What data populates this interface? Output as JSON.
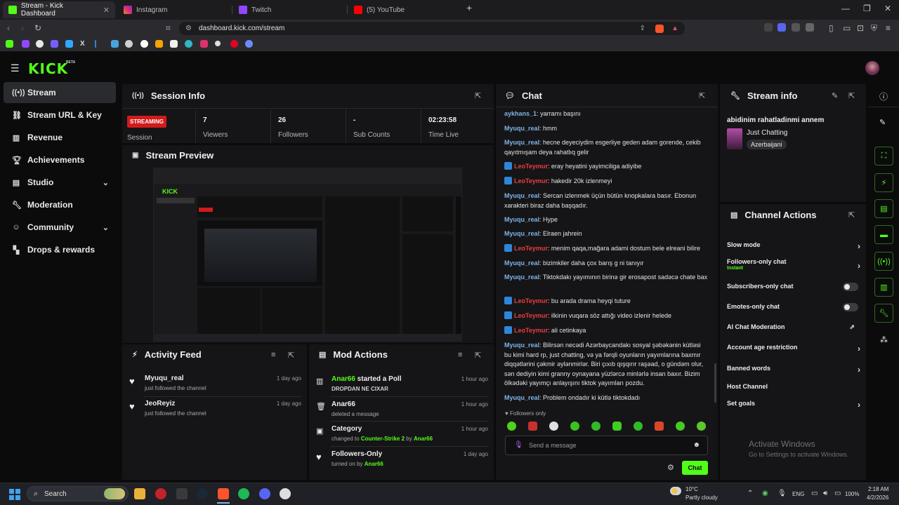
{
  "browser": {
    "tabs": [
      {
        "title": "Stream - Kick Dashboard",
        "color": "#53fc18",
        "active": true
      },
      {
        "title": "Instagram",
        "color": "#e1306c",
        "active": false
      },
      {
        "title": "Twitch",
        "color": "#9146ff",
        "active": false
      },
      {
        "title": "(5) YouTube",
        "color": "#ff0000",
        "active": false
      }
    ],
    "url": "dashboard.kick.com/stream"
  },
  "header": {
    "logo": "KICK",
    "beta": "BETA"
  },
  "sidebar": {
    "items": [
      {
        "label": "Stream",
        "icon": "stream-icon"
      },
      {
        "label": "Stream URL & Key",
        "icon": "link-icon"
      },
      {
        "label": "Revenue",
        "icon": "chart-icon"
      },
      {
        "label": "Achievements",
        "icon": "trophy-icon"
      },
      {
        "label": "Studio",
        "icon": "studio-icon"
      },
      {
        "label": "Moderation",
        "icon": "wrench-icon"
      },
      {
        "label": "Community",
        "icon": "community-icon"
      },
      {
        "label": "Drops & rewards",
        "icon": "drops-icon"
      }
    ]
  },
  "session": {
    "title": "Session Info",
    "status": "STREAMING",
    "stats": [
      {
        "value": "",
        "label": "Session"
      },
      {
        "value": "7",
        "label": "Viewers"
      },
      {
        "value": "26",
        "label": "Followers"
      },
      {
        "value": "-",
        "label": "Sub Counts"
      },
      {
        "value": "02:23:58",
        "label": "Time Live"
      }
    ]
  },
  "preview": {
    "title": "Stream Preview"
  },
  "activity": {
    "title": "Activity Feed",
    "items": [
      {
        "name": "Myuqu_real",
        "sub": "just followed the channel",
        "time": "1 day ago"
      },
      {
        "name": "JeoReyiz",
        "sub": "just followed the channel",
        "time": "1 day ago"
      }
    ]
  },
  "mod": {
    "title": "Mod Actions",
    "items": [
      {
        "user": "Anar66",
        "action": " started a Poll",
        "sub": "DROPDAN NE CIXAR",
        "time": "1 hour ago"
      },
      {
        "user": "Anar66",
        "action": "",
        "sub": "deleted a message",
        "time": "1 hour ago"
      },
      {
        "user": "",
        "action": "Category",
        "sub_pre": "changed to ",
        "sub_green": "Counter-Strike 2",
        "sub_mid": " by ",
        "sub_user": "Anar66",
        "time": "1 hour ago"
      },
      {
        "user": "",
        "action": "Followers-Only",
        "sub_pre": "turned on by ",
        "sub_user": "Anar66",
        "time": "1 day ago"
      }
    ]
  },
  "chat": {
    "title": "Chat",
    "messages": [
      {
        "user": "aykhans_1",
        "text": "yarramı başını",
        "red": false
      },
      {
        "user": "Myuqu_real",
        "text": "hmm",
        "red": false
      },
      {
        "user": "Myuqu_real",
        "text": "hecne deyeciydim esgerliye geden adam gorende, cekib qayıtmışam deya rahatlıq gelir",
        "red": false
      },
      {
        "user": "LeoTeymur",
        "text": "eray heyatini yayimciliga adiyibe",
        "red": true
      },
      {
        "user": "LeoTeymur",
        "text": "hakedir 20k izlenmeyi",
        "red": true
      },
      {
        "user": "Myuqu_real",
        "text": "Sercan izlenmek üçün bütün knopkalara basır. Ebonun xarakteri biraz daha başqadır.",
        "red": false
      },
      {
        "user": "Myuqu_real",
        "text": "Hype",
        "red": false
      },
      {
        "user": "Myuqu_real",
        "text": "Elraen jahrein",
        "red": false
      },
      {
        "user": "LeoTeymur",
        "text": "menim qaqa,mağara adami dostum bele elreani bilire",
        "red": true
      },
      {
        "user": "Myuqu_real",
        "text": "bizimkiler daha çox barış g ni tanıyır",
        "red": false
      },
      {
        "user": "Myuqu_real",
        "text": "Tiktokdakı yayımının birinə gir erosapost sadəcə chate bax",
        "red": false
      },
      {
        "user": "LeoTeymur",
        "text": "bu arada drama heyqi tuture",
        "red": true
      },
      {
        "user": "LeoTeymur",
        "text": "ilkinin vuqara söz attığı video izlenir helede",
        "red": true
      },
      {
        "user": "LeoTeymur",
        "text": "ali cetinkaya",
        "red": true
      },
      {
        "user": "Myuqu_real",
        "text": "Bilirsən necədi Azərbaycandakı sosyal şəbəkənin kütləsi bu kimi hard rp, just chatting, və ya fərqli oyunların yayımlarına baxmır diqqətlərini çəkmir əylənmirlər. Biri çıxıb qışqırır raşəad, o gündəm olur, sən dediyin kimi granny oynayana yüzlərcə minlərlə insan baxır. Bizim ölkədəki yayımçı anlayışını tiktok yayımları pozdu.",
        "red": false
      },
      {
        "user": "Myuqu_real",
        "text": "Problem ondadır ki kütlə tiktokdadı",
        "red": false
      }
    ],
    "followers_only": "Followers only",
    "placeholder": "Send a message",
    "send_label": "Chat"
  },
  "streaminfo": {
    "title": "Stream info",
    "stream_title": "abidinim rahatladinmi annem",
    "category": "Just Chatting",
    "tag": "Azerbaijani"
  },
  "channel_actions": {
    "title": "Channel Actions",
    "items": [
      {
        "label": "Slow mode",
        "sub": "",
        "control": "chevron"
      },
      {
        "label": "Followers-only chat",
        "sub": "Instant",
        "control": "chevron"
      },
      {
        "label": "Subscribers-only chat",
        "sub": "",
        "control": "toggle"
      },
      {
        "label": "Emotes-only chat",
        "sub": "",
        "control": "toggle"
      },
      {
        "label": "AI Chat Moderation",
        "sub": "",
        "control": "external"
      },
      {
        "label": "Account age restriction",
        "sub": "",
        "control": "chevron"
      },
      {
        "label": "Banned words",
        "sub": "",
        "control": "chevron"
      },
      {
        "label": "Host Channel",
        "sub": "",
        "control": "none"
      },
      {
        "label": "Set goals",
        "sub": "",
        "control": "chevron"
      }
    ]
  },
  "watermark": {
    "line1": "Activate Windows",
    "line2": "Go to Settings to activate Windows."
  },
  "taskbar": {
    "search": "Search",
    "weather_temp": "10°C",
    "weather_desc": "Partly cloudy",
    "lang": "ENG",
    "battery": "100%",
    "time": "2:18 AM",
    "date": "4/2/2026"
  },
  "colors": {
    "accent": "#53fc18",
    "live": "#d11b1b",
    "panel": "#151517",
    "background": "#0b0b0c"
  }
}
